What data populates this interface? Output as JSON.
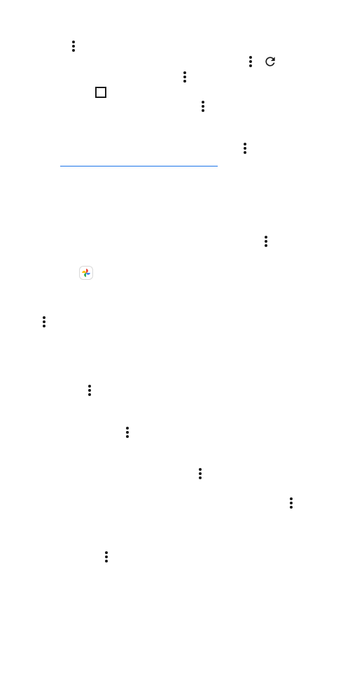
{
  "screen": {
    "icons": {
      "more_options": "three-dot-vertical-icon",
      "refresh": "refresh-icon",
      "checkbox": "checkbox-outline-icon",
      "app": "pinwheel-photos-app-icon"
    },
    "colors": {
      "icon": "#1a1a1a",
      "link": "#1a73e8",
      "pinwheel": [
        "#ea4335",
        "#fbbc05",
        "#34a853",
        "#4285f4"
      ]
    }
  }
}
